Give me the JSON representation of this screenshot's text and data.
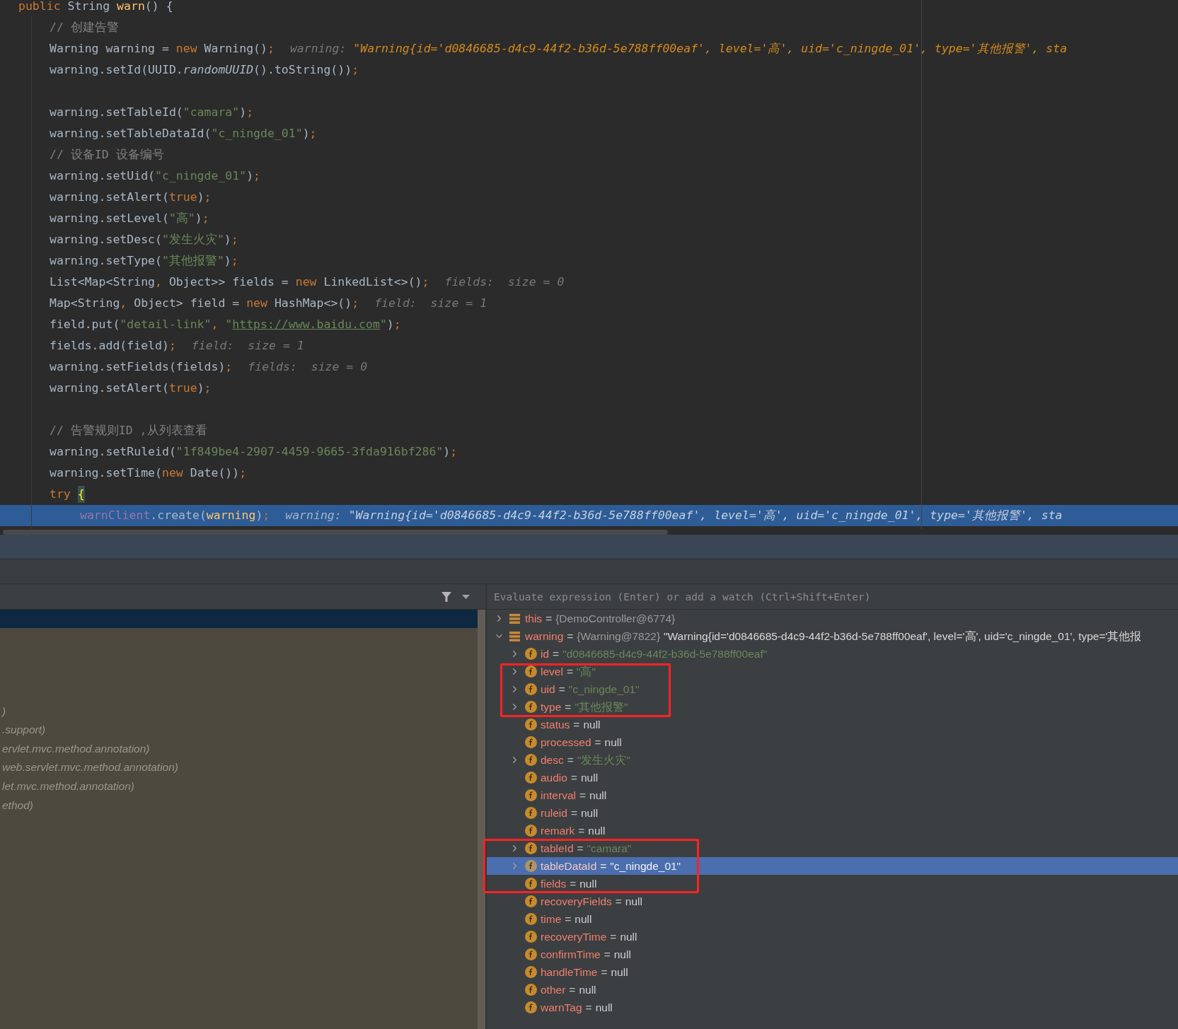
{
  "editor": {
    "lines": [
      {
        "kind": "top",
        "execution": false,
        "tokens": [
          {
            "text": "public",
            "kind": "keyword"
          },
          {
            "text": " String ",
            "kind": "plain"
          },
          {
            "text": "warn",
            "kind": "method"
          },
          {
            "text": "() {",
            "kind": "plain"
          }
        ]
      },
      {
        "kind": "body",
        "execution": false,
        "tokens": [
          {
            "text": "// 创建告警",
            "kind": "comment"
          }
        ]
      },
      {
        "kind": "body",
        "execution": false,
        "tokens": [
          {
            "text": "Warning warning = ",
            "kind": "plain"
          },
          {
            "text": "new",
            "kind": "keyword"
          },
          {
            "text": " Warning()",
            "kind": "plain"
          },
          {
            "text": ";",
            "kind": "keyword"
          },
          {
            "text": "warning: ",
            "kind": "hint_label"
          },
          {
            "text": "\"Warning{id='d0846685-d4c9-44f2-b36d-5e788ff00eaf', level='高', uid='c_ningde_01', type='其他报警', sta",
            "kind": "hint_value"
          }
        ]
      },
      {
        "kind": "body",
        "execution": false,
        "tokens": [
          {
            "text": "warning.setId(UUID.",
            "kind": "plain"
          },
          {
            "text": "randomUUID",
            "kind": "italic"
          },
          {
            "text": "().toString())",
            "kind": "plain"
          },
          {
            "text": ";",
            "kind": "keyword"
          }
        ]
      },
      {
        "kind": "body",
        "execution": false
      },
      {
        "kind": "body",
        "execution": false,
        "tokens": [
          {
            "text": "warning.setTableId(",
            "kind": "plain"
          },
          {
            "text": "\"camara\"",
            "kind": "string"
          },
          {
            "text": ")",
            "kind": "plain"
          },
          {
            "text": ";",
            "kind": "keyword"
          }
        ]
      },
      {
        "kind": "body",
        "execution": false,
        "tokens": [
          {
            "text": "warning.setTableDataId(",
            "kind": "plain"
          },
          {
            "text": "\"c_ningde_01\"",
            "kind": "string"
          },
          {
            "text": ")",
            "kind": "plain"
          },
          {
            "text": ";",
            "kind": "keyword"
          }
        ]
      },
      {
        "kind": "body",
        "execution": false,
        "tokens": [
          {
            "text": "// 设备ID 设备编号",
            "kind": "comment"
          }
        ]
      },
      {
        "kind": "body",
        "execution": false,
        "tokens": [
          {
            "text": "warning.setUid(",
            "kind": "plain"
          },
          {
            "text": "\"c_ningde_01\"",
            "kind": "string"
          },
          {
            "text": ")",
            "kind": "plain"
          },
          {
            "text": ";",
            "kind": "keyword"
          }
        ]
      },
      {
        "kind": "body",
        "execution": false,
        "tokens": [
          {
            "text": "warning.setAlert(",
            "kind": "plain"
          },
          {
            "text": "true",
            "kind": "keyword"
          },
          {
            "text": ")",
            "kind": "plain"
          },
          {
            "text": ";",
            "kind": "keyword"
          }
        ]
      },
      {
        "kind": "body",
        "execution": false,
        "tokens": [
          {
            "text": "warning.setLevel(",
            "kind": "plain"
          },
          {
            "text": "\"高\"",
            "kind": "string"
          },
          {
            "text": ")",
            "kind": "plain"
          },
          {
            "text": ";",
            "kind": "keyword"
          }
        ]
      },
      {
        "kind": "body",
        "execution": false,
        "tokens": [
          {
            "text": "warning.setDesc(",
            "kind": "plain"
          },
          {
            "text": "\"发生火灾\"",
            "kind": "string"
          },
          {
            "text": ")",
            "kind": "plain"
          },
          {
            "text": ";",
            "kind": "keyword"
          }
        ]
      },
      {
        "kind": "body",
        "execution": false,
        "tokens": [
          {
            "text": "warning.setType(",
            "kind": "plain"
          },
          {
            "text": "\"其他报警\"",
            "kind": "string"
          },
          {
            "text": ")",
            "kind": "plain"
          },
          {
            "text": ";",
            "kind": "keyword"
          }
        ]
      },
      {
        "kind": "body",
        "execution": false,
        "tokens": [
          {
            "text": "List<Map<String",
            "kind": "plain"
          },
          {
            "text": ",",
            "kind": "keyword"
          },
          {
            "text": " Object>> fields = ",
            "kind": "plain"
          },
          {
            "text": "new",
            "kind": "keyword"
          },
          {
            "text": " LinkedList<>()",
            "kind": "plain"
          },
          {
            "text": ";",
            "kind": "keyword"
          },
          {
            "text": "fields:  size = 0",
            "kind": "hint_label"
          }
        ]
      },
      {
        "kind": "body",
        "execution": false,
        "tokens": [
          {
            "text": "Map<String",
            "kind": "plain"
          },
          {
            "text": ",",
            "kind": "keyword"
          },
          {
            "text": " Object> field = ",
            "kind": "plain"
          },
          {
            "text": "new",
            "kind": "keyword"
          },
          {
            "text": " HashMap<>()",
            "kind": "plain"
          },
          {
            "text": ";",
            "kind": "keyword"
          },
          {
            "text": "field:  size = 1",
            "kind": "hint_label"
          }
        ]
      },
      {
        "kind": "body",
        "execution": false,
        "tokens": [
          {
            "text": "field.put(",
            "kind": "plain"
          },
          {
            "text": "\"detail-link\"",
            "kind": "string"
          },
          {
            "text": ",",
            "kind": "keyword"
          },
          {
            "text": " \"",
            "kind": "string"
          },
          {
            "text": "https://www.baidu.com",
            "kind": "link"
          },
          {
            "text": "\"",
            "kind": "string"
          },
          {
            "text": ")",
            "kind": "plain"
          },
          {
            "text": ";",
            "kind": "keyword"
          }
        ]
      },
      {
        "kind": "body",
        "execution": false,
        "tokens": [
          {
            "text": "fields.add(field)",
            "kind": "plain"
          },
          {
            "text": ";",
            "kind": "keyword"
          },
          {
            "text": "field:  size = 1",
            "kind": "hint_label"
          }
        ]
      },
      {
        "kind": "body",
        "execution": false,
        "tokens": [
          {
            "text": "warning.setFields(fields)",
            "kind": "plain"
          },
          {
            "text": ";",
            "kind": "keyword"
          },
          {
            "text": "fields:  size = 0",
            "kind": "hint_label"
          }
        ]
      },
      {
        "kind": "body",
        "execution": false,
        "tokens": [
          {
            "text": "warning.setAlert(",
            "kind": "plain"
          },
          {
            "text": "true",
            "kind": "keyword"
          },
          {
            "text": ")",
            "kind": "plain"
          },
          {
            "text": ";",
            "kind": "keyword"
          }
        ]
      },
      {
        "kind": "body",
        "execution": false
      },
      {
        "kind": "body",
        "execution": false,
        "tokens": [
          {
            "text": "// 告警规则ID ,从列表查看",
            "kind": "comment"
          }
        ]
      },
      {
        "kind": "body",
        "execution": false,
        "tokens": [
          {
            "text": "warning.setRuleid(",
            "kind": "plain"
          },
          {
            "text": "\"1f849be4-2907-4459-9665-3fda916bf286\"",
            "kind": "string"
          },
          {
            "text": ")",
            "kind": "plain"
          },
          {
            "text": ";",
            "kind": "keyword"
          }
        ]
      },
      {
        "kind": "body",
        "execution": false,
        "tokens": [
          {
            "text": "warning.setTime(",
            "kind": "plain"
          },
          {
            "text": "new",
            "kind": "keyword"
          },
          {
            "text": " Date())",
            "kind": "plain"
          },
          {
            "text": ";",
            "kind": "keyword"
          }
        ]
      },
      {
        "kind": "body",
        "execution": false,
        "tokens": [
          {
            "text": "try",
            "kind": "keyword"
          },
          {
            "text": "{",
            "kind": "brace"
          }
        ]
      },
      {
        "kind": "block",
        "execution": true,
        "tokens": [
          {
            "text": "warnClient",
            "kind": "field"
          },
          {
            "text": ".create(",
            "kind": "plain"
          },
          {
            "text": "warning",
            "kind": "usage"
          },
          {
            "text": ")",
            "kind": "plain"
          },
          {
            "text": ";",
            "kind": "keyword"
          },
          {
            "text": "warning: ",
            "kind": "hint_label"
          },
          {
            "text": "\"Warning{id='d0846685-d4c9-44f2-b36d-5e788ff00eaf', level='高', uid='c_ningde_01', type='其他报警', sta",
            "kind": "hint_value"
          }
        ]
      }
    ]
  },
  "frames": {
    "rows": [
      ")",
      ".support)",
      "ervlet.mvc.method.annotation)",
      "web.servlet.mvc.method.annotation)",
      "let.mvc.method.annotation)",
      "ethod)"
    ]
  },
  "variables": {
    "placeholder": "Evaluate expression (Enter) or add a watch (Ctrl+Shift+Enter)",
    "nodes": [
      {
        "kind": "object",
        "name": "this",
        "separator": "=",
        "value": {
          "text": "{DemoController@6774}",
          "kind": "object"
        },
        "expandable": true,
        "expanded": false,
        "selected": false
      },
      {
        "kind": "object",
        "name": "warning",
        "separator": "=",
        "value": {
          "text": "{Warning@7822}",
          "kind": "object"
        },
        "detail": "\"Warning{id='d0846685-d4c9-44f2-b36d-5e788ff00eaf', level='高', uid='c_ningde_01', type='其他报",
        "expandable": true,
        "expanded": true,
        "selected": false,
        "children": [
          {
            "kind": "field",
            "name": "id",
            "separator": "=",
            "value": {
              "text": "\"d0846685-d4c9-44f2-b36d-5e788ff00eaf\"",
              "kind": "string"
            },
            "expandable": true,
            "expanded": false,
            "selected": false
          },
          {
            "kind": "field",
            "name": "level",
            "separator": "=",
            "value": {
              "text": "\"高\"",
              "kind": "string"
            },
            "expandable": true,
            "expanded": false,
            "selected": false
          },
          {
            "kind": "field",
            "name": "uid",
            "separator": "=",
            "value": {
              "text": "\"c_ningde_01\"",
              "kind": "string"
            },
            "expandable": true,
            "expanded": false,
            "selected": false
          },
          {
            "kind": "field",
            "name": "type",
            "separator": "=",
            "value": {
              "text": "\"其他报警\"",
              "kind": "string"
            },
            "expandable": true,
            "expanded": false,
            "selected": false
          },
          {
            "kind": "field",
            "name": "status",
            "separator": "=",
            "value": {
              "text": "null",
              "kind": "null"
            },
            "expandable": false,
            "expanded": false,
            "selected": false
          },
          {
            "kind": "field",
            "name": "processed",
            "separator": "=",
            "value": {
              "text": "null",
              "kind": "null"
            },
            "expandable": false,
            "expanded": false,
            "selected": false
          },
          {
            "kind": "field",
            "name": "desc",
            "separator": "=",
            "value": {
              "text": "\"发生火灾\"",
              "kind": "string"
            },
            "expandable": true,
            "expanded": false,
            "selected": false
          },
          {
            "kind": "field",
            "name": "audio",
            "separator": "=",
            "value": {
              "text": "null",
              "kind": "null"
            },
            "expandable": false,
            "expanded": false,
            "selected": false
          },
          {
            "kind": "field",
            "name": "interval",
            "separator": "=",
            "value": {
              "text": "null",
              "kind": "null"
            },
            "expandable": false,
            "expanded": false,
            "selected": false
          },
          {
            "kind": "field",
            "name": "ruleid",
            "separator": "=",
            "value": {
              "text": "null",
              "kind": "null"
            },
            "expandable": false,
            "expanded": false,
            "selected": false
          },
          {
            "kind": "field",
            "name": "remark",
            "separator": "=",
            "value": {
              "text": "null",
              "kind": "null"
            },
            "expandable": false,
            "expanded": false,
            "selected": false
          },
          {
            "kind": "field",
            "name": "tableId",
            "separator": "=",
            "value": {
              "text": "\"camara\"",
              "kind": "string"
            },
            "expandable": true,
            "expanded": false,
            "selected": false
          },
          {
            "kind": "field",
            "name": "tableDataId",
            "separator": "=",
            "value": {
              "text": "\"c_ningde_01\"",
              "kind": "string"
            },
            "expandable": true,
            "expanded": false,
            "selected": true
          },
          {
            "kind": "field",
            "name": "fields",
            "separator": "=",
            "value": {
              "text": "null",
              "kind": "null"
            },
            "expandable": false,
            "expanded": false,
            "selected": false
          },
          {
            "kind": "field",
            "name": "recoveryFields",
            "separator": "=",
            "value": {
              "text": "null",
              "kind": "null"
            },
            "expandable": false,
            "expanded": false,
            "selected": false
          },
          {
            "kind": "field",
            "name": "time",
            "separator": "=",
            "value": {
              "text": "null",
              "kind": "null"
            },
            "expandable": false,
            "expanded": false,
            "selected": false
          },
          {
            "kind": "field",
            "name": "recoveryTime",
            "separator": "=",
            "value": {
              "text": "null",
              "kind": "null"
            },
            "expandable": false,
            "expanded": false,
            "selected": false
          },
          {
            "kind": "field",
            "name": "confirmTime",
            "separator": "=",
            "value": {
              "text": "null",
              "kind": "null"
            },
            "expandable": false,
            "expanded": false,
            "selected": false
          },
          {
            "kind": "field",
            "name": "handleTime",
            "separator": "=",
            "value": {
              "text": "null",
              "kind": "null"
            },
            "expandable": false,
            "expanded": false,
            "selected": false
          },
          {
            "kind": "field",
            "name": "other",
            "separator": "=",
            "value": {
              "text": "null",
              "kind": "null"
            },
            "expandable": false,
            "expanded": false,
            "selected": false
          },
          {
            "kind": "field",
            "name": "warnTag",
            "separator": "=",
            "value": {
              "text": "null",
              "kind": "null"
            },
            "expandable": false,
            "expanded": false,
            "selected": false
          }
        ]
      }
    ]
  }
}
